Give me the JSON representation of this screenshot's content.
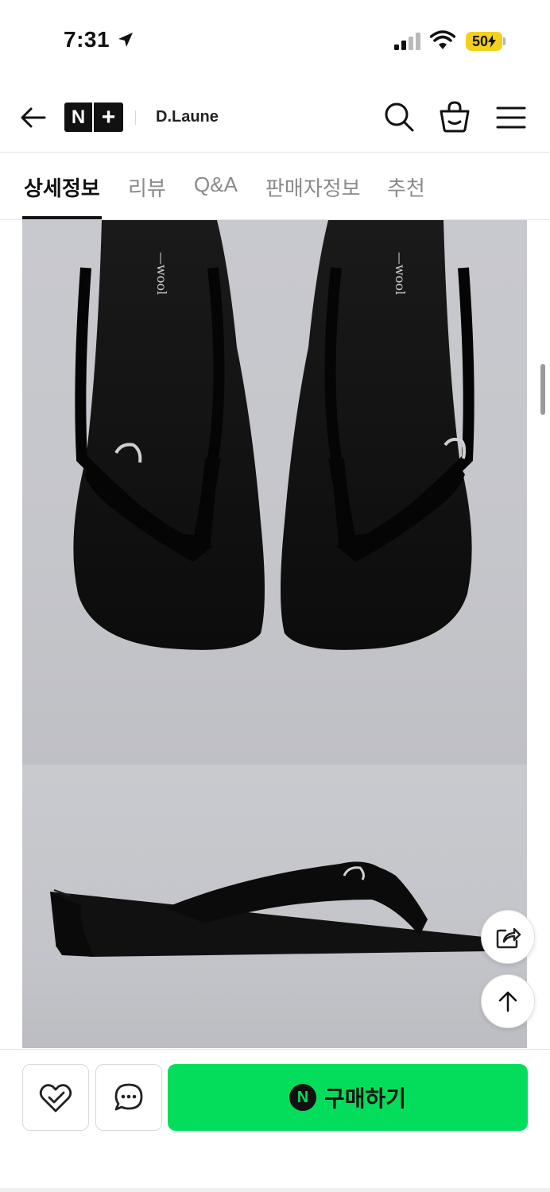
{
  "status_bar": {
    "time": "7:31",
    "battery": "50"
  },
  "header": {
    "logo_n": "N",
    "logo_plus": "+",
    "store_name": "D.Laune",
    "icons": [
      "back-arrow-icon",
      "search-icon",
      "shopping-basket-icon",
      "hamburger-menu-icon"
    ]
  },
  "tabs": [
    {
      "label": "상세정보",
      "active": true
    },
    {
      "label": "리뷰",
      "active": false
    },
    {
      "label": "Q&A",
      "active": false
    },
    {
      "label": "판매자정보",
      "active": false
    },
    {
      "label": "추천",
      "active": false
    }
  ],
  "product_images": {
    "insole_brand_text": "—wool",
    "photos": [
      "black thong wedge sandals pair, top view",
      "black thong wedge sandal, side view"
    ]
  },
  "floating": {
    "icons": [
      "share-icon",
      "arrow-up-icon"
    ]
  },
  "bottom_bar": {
    "buy_badge": "N",
    "buy_label": "구매하기",
    "icons": [
      "heart-check-icon",
      "chat-bubble-icon"
    ],
    "accent_color": "#04dd5c"
  }
}
